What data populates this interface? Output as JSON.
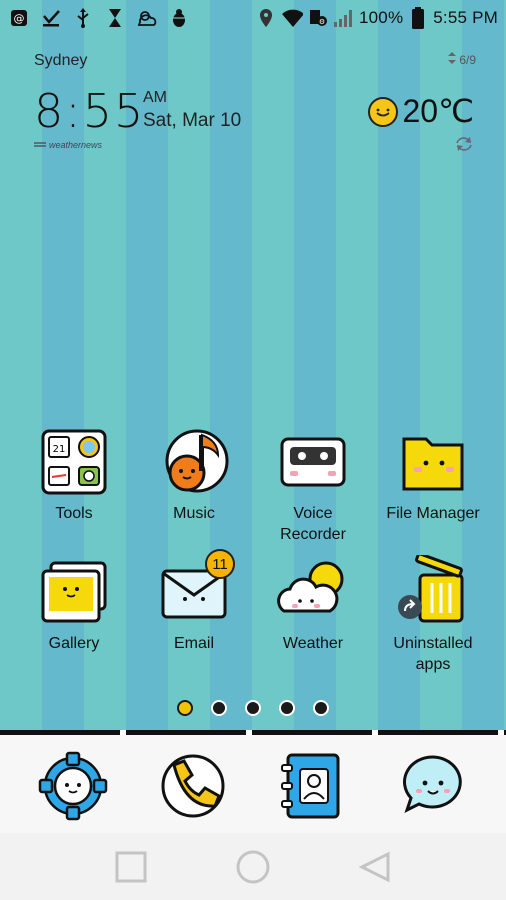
{
  "status_bar": {
    "battery": "100%",
    "time": "5:55 PM",
    "icons_left": [
      "at-sign-icon",
      "download-check-icon",
      "usb-icon",
      "hourglass-icon",
      "weather-cloud-icon",
      "bug-icon"
    ],
    "icons_right": [
      "location-pin-icon",
      "wifi-icon",
      "data-saver-icon",
      "signal-icon"
    ]
  },
  "clock_widget": {
    "city": "Sydney",
    "time": "8:55",
    "ampm": "AM",
    "date": "Sat, Mar 10",
    "temperature": "20℃",
    "page_indicator": "6/9",
    "provider": "weathernews"
  },
  "apps": [
    {
      "label": "Tools"
    },
    {
      "label": "Music"
    },
    {
      "label": "Voice\nRecorder"
    },
    {
      "label": "File Manager"
    },
    {
      "label": "Gallery"
    },
    {
      "label": "Email",
      "badge": "11"
    },
    {
      "label": "Weather"
    },
    {
      "label": "Uninstalled\napps"
    }
  ],
  "home_pages": {
    "count": 5,
    "active": 0
  },
  "dock": [
    "Settings",
    "Phone",
    "Contacts",
    "Messaging"
  ],
  "nav": [
    "recents-button",
    "home-button",
    "back-button"
  ],
  "colors": {
    "accent": "#f2c300",
    "wallpaper_a": "#6ec8c8",
    "wallpaper_b": "#65b9cc"
  }
}
